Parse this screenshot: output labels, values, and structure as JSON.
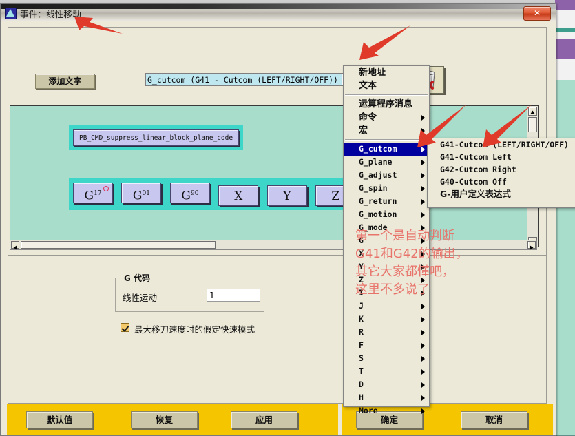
{
  "window": {
    "title": "事件：线性移动",
    "close_label": "✕",
    "icon": "app-icon"
  },
  "toolbar": {
    "add_text_button": "添加文字",
    "combo_value": "G_cutcom (G41 - Cutcom (LEFT/RIGHT/OFF))",
    "combo_arrow_icon": "dropdown-arrow-icon",
    "trash_icon": "trash-delete-icon"
  },
  "canvas": {
    "command_node": "PB_CMD_suppress_linear_block_plane_code",
    "axis_nodes": [
      {
        "main": "G",
        "sub": "17",
        "marked": true
      },
      {
        "main": "G",
        "sub": "01",
        "marked": false
      },
      {
        "main": "G",
        "sub": "90",
        "marked": false
      },
      {
        "main": "X",
        "sub": "",
        "marked": false
      },
      {
        "main": "Y",
        "sub": "",
        "marked": false
      },
      {
        "main": "Z",
        "sub": "",
        "marked": false
      }
    ]
  },
  "settings": {
    "group_legend": "G 代码",
    "gcode_label": "线性运动",
    "gcode_value": "1",
    "checkbox_label": "最大移刀速度时的假定快速模式",
    "checkbox_checked": true
  },
  "footer": {
    "left_buttons": [
      "默认值",
      "恢复",
      "应用"
    ],
    "right_buttons": [
      "确定",
      "取消"
    ]
  },
  "menu": {
    "items": [
      {
        "label": "新地址",
        "type": "cjk",
        "submenu": false,
        "selected": false
      },
      {
        "label": "文本",
        "type": "cjk",
        "submenu": false,
        "selected": false
      },
      {
        "separator": true
      },
      {
        "label": "运算程序消息",
        "type": "cjk",
        "submenu": false,
        "selected": false
      },
      {
        "label": "命令",
        "type": "cjk",
        "submenu": true,
        "selected": false
      },
      {
        "label": "宏",
        "type": "cjk",
        "submenu": true,
        "selected": false
      },
      {
        "separator": true
      },
      {
        "label": "G_cutcom",
        "type": "mono",
        "submenu": true,
        "selected": true
      },
      {
        "label": "G_plane",
        "type": "mono",
        "submenu": true,
        "selected": false
      },
      {
        "label": "G_adjust",
        "type": "mono",
        "submenu": true,
        "selected": false
      },
      {
        "label": "G_spin",
        "type": "mono",
        "submenu": true,
        "selected": false
      },
      {
        "label": "G_return",
        "type": "mono",
        "submenu": true,
        "selected": false
      },
      {
        "label": "G_motion",
        "type": "mono",
        "submenu": true,
        "selected": false
      },
      {
        "label": "G_mode",
        "type": "mono",
        "submenu": true,
        "selected": false
      },
      {
        "label": "G",
        "type": "mono",
        "submenu": true,
        "selected": false
      },
      {
        "label": "X",
        "type": "mono",
        "submenu": true,
        "selected": false
      },
      {
        "label": "Y",
        "type": "mono",
        "submenu": true,
        "selected": false
      },
      {
        "label": "Z",
        "type": "mono",
        "submenu": true,
        "selected": false
      },
      {
        "label": "I",
        "type": "mono",
        "submenu": true,
        "selected": false
      },
      {
        "label": "J",
        "type": "mono",
        "submenu": true,
        "selected": false
      },
      {
        "label": "K",
        "type": "mono",
        "submenu": true,
        "selected": false
      },
      {
        "label": "R",
        "type": "mono",
        "submenu": true,
        "selected": false
      },
      {
        "label": "F",
        "type": "mono",
        "submenu": true,
        "selected": false
      },
      {
        "label": "S",
        "type": "mono",
        "submenu": true,
        "selected": false
      },
      {
        "label": "T",
        "type": "mono",
        "submenu": true,
        "selected": false
      },
      {
        "label": "D",
        "type": "mono",
        "submenu": true,
        "selected": false
      },
      {
        "label": "H",
        "type": "mono",
        "submenu": true,
        "selected": false
      },
      {
        "label": "More",
        "type": "mono",
        "submenu": true,
        "selected": false
      }
    ]
  },
  "submenu": {
    "items": [
      {
        "label": "G41-Cutcom (LEFT/RIGHT/OFF)",
        "type": "mono"
      },
      {
        "label": "G41-Cutcom Left",
        "type": "mono"
      },
      {
        "label": "G42-Cutcom Right",
        "type": "mono"
      },
      {
        "label": "G40-Cutcom Off",
        "type": "mono"
      },
      {
        "label": "G-用户定义表达式",
        "type": "cjk"
      }
    ]
  },
  "annotations": {
    "text_lines": [
      "第一个是自动判断",
      "G41和G42的输出，",
      "其它大家都懂吧，",
      "这里不多说了"
    ],
    "arrow_color": "#e03a2a",
    "arrow_count": 3
  },
  "colors": {
    "accent_yellow": "#f5c600",
    "canvas_green": "#a9ddcb",
    "node_teal": "#3ed6c8",
    "node_lavender": "#c8c7f0",
    "menu_highlight": "#00009e",
    "annotation_red": "#e8736b"
  }
}
